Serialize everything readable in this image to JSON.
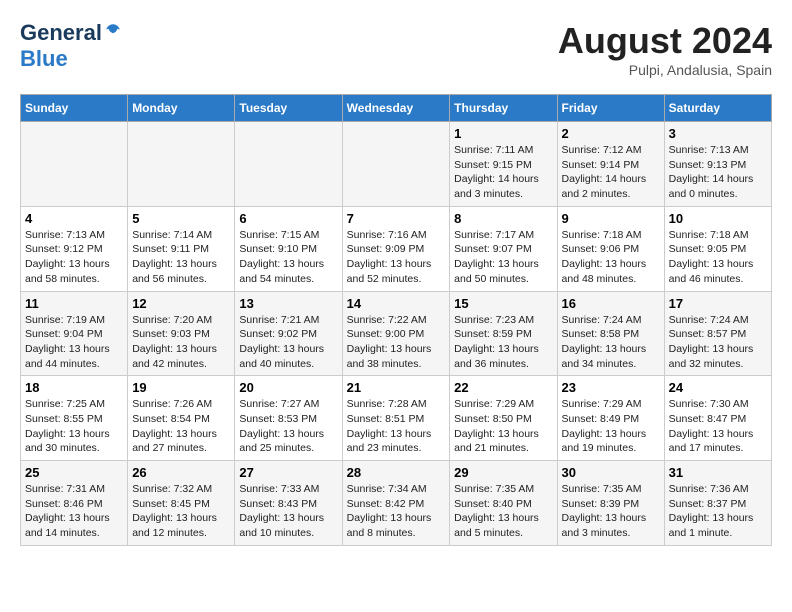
{
  "header": {
    "logo_general": "General",
    "logo_blue": "Blue",
    "title": "August 2024",
    "location": "Pulpi, Andalusia, Spain"
  },
  "weekdays": [
    "Sunday",
    "Monday",
    "Tuesday",
    "Wednesday",
    "Thursday",
    "Friday",
    "Saturday"
  ],
  "weeks": [
    [
      {
        "day": "",
        "text": ""
      },
      {
        "day": "",
        "text": ""
      },
      {
        "day": "",
        "text": ""
      },
      {
        "day": "",
        "text": ""
      },
      {
        "day": "1",
        "text": "Sunrise: 7:11 AM\nSunset: 9:15 PM\nDaylight: 14 hours\nand 3 minutes."
      },
      {
        "day": "2",
        "text": "Sunrise: 7:12 AM\nSunset: 9:14 PM\nDaylight: 14 hours\nand 2 minutes."
      },
      {
        "day": "3",
        "text": "Sunrise: 7:13 AM\nSunset: 9:13 PM\nDaylight: 14 hours\nand 0 minutes."
      }
    ],
    [
      {
        "day": "4",
        "text": "Sunrise: 7:13 AM\nSunset: 9:12 PM\nDaylight: 13 hours\nand 58 minutes."
      },
      {
        "day": "5",
        "text": "Sunrise: 7:14 AM\nSunset: 9:11 PM\nDaylight: 13 hours\nand 56 minutes."
      },
      {
        "day": "6",
        "text": "Sunrise: 7:15 AM\nSunset: 9:10 PM\nDaylight: 13 hours\nand 54 minutes."
      },
      {
        "day": "7",
        "text": "Sunrise: 7:16 AM\nSunset: 9:09 PM\nDaylight: 13 hours\nand 52 minutes."
      },
      {
        "day": "8",
        "text": "Sunrise: 7:17 AM\nSunset: 9:07 PM\nDaylight: 13 hours\nand 50 minutes."
      },
      {
        "day": "9",
        "text": "Sunrise: 7:18 AM\nSunset: 9:06 PM\nDaylight: 13 hours\nand 48 minutes."
      },
      {
        "day": "10",
        "text": "Sunrise: 7:18 AM\nSunset: 9:05 PM\nDaylight: 13 hours\nand 46 minutes."
      }
    ],
    [
      {
        "day": "11",
        "text": "Sunrise: 7:19 AM\nSunset: 9:04 PM\nDaylight: 13 hours\nand 44 minutes."
      },
      {
        "day": "12",
        "text": "Sunrise: 7:20 AM\nSunset: 9:03 PM\nDaylight: 13 hours\nand 42 minutes."
      },
      {
        "day": "13",
        "text": "Sunrise: 7:21 AM\nSunset: 9:02 PM\nDaylight: 13 hours\nand 40 minutes."
      },
      {
        "day": "14",
        "text": "Sunrise: 7:22 AM\nSunset: 9:00 PM\nDaylight: 13 hours\nand 38 minutes."
      },
      {
        "day": "15",
        "text": "Sunrise: 7:23 AM\nSunset: 8:59 PM\nDaylight: 13 hours\nand 36 minutes."
      },
      {
        "day": "16",
        "text": "Sunrise: 7:24 AM\nSunset: 8:58 PM\nDaylight: 13 hours\nand 34 minutes."
      },
      {
        "day": "17",
        "text": "Sunrise: 7:24 AM\nSunset: 8:57 PM\nDaylight: 13 hours\nand 32 minutes."
      }
    ],
    [
      {
        "day": "18",
        "text": "Sunrise: 7:25 AM\nSunset: 8:55 PM\nDaylight: 13 hours\nand 30 minutes."
      },
      {
        "day": "19",
        "text": "Sunrise: 7:26 AM\nSunset: 8:54 PM\nDaylight: 13 hours\nand 27 minutes."
      },
      {
        "day": "20",
        "text": "Sunrise: 7:27 AM\nSunset: 8:53 PM\nDaylight: 13 hours\nand 25 minutes."
      },
      {
        "day": "21",
        "text": "Sunrise: 7:28 AM\nSunset: 8:51 PM\nDaylight: 13 hours\nand 23 minutes."
      },
      {
        "day": "22",
        "text": "Sunrise: 7:29 AM\nSunset: 8:50 PM\nDaylight: 13 hours\nand 21 minutes."
      },
      {
        "day": "23",
        "text": "Sunrise: 7:29 AM\nSunset: 8:49 PM\nDaylight: 13 hours\nand 19 minutes."
      },
      {
        "day": "24",
        "text": "Sunrise: 7:30 AM\nSunset: 8:47 PM\nDaylight: 13 hours\nand 17 minutes."
      }
    ],
    [
      {
        "day": "25",
        "text": "Sunrise: 7:31 AM\nSunset: 8:46 PM\nDaylight: 13 hours\nand 14 minutes."
      },
      {
        "day": "26",
        "text": "Sunrise: 7:32 AM\nSunset: 8:45 PM\nDaylight: 13 hours\nand 12 minutes."
      },
      {
        "day": "27",
        "text": "Sunrise: 7:33 AM\nSunset: 8:43 PM\nDaylight: 13 hours\nand 10 minutes."
      },
      {
        "day": "28",
        "text": "Sunrise: 7:34 AM\nSunset: 8:42 PM\nDaylight: 13 hours\nand 8 minutes."
      },
      {
        "day": "29",
        "text": "Sunrise: 7:35 AM\nSunset: 8:40 PM\nDaylight: 13 hours\nand 5 minutes."
      },
      {
        "day": "30",
        "text": "Sunrise: 7:35 AM\nSunset: 8:39 PM\nDaylight: 13 hours\nand 3 minutes."
      },
      {
        "day": "31",
        "text": "Sunrise: 7:36 AM\nSunset: 8:37 PM\nDaylight: 13 hours\nand 1 minute."
      }
    ]
  ]
}
